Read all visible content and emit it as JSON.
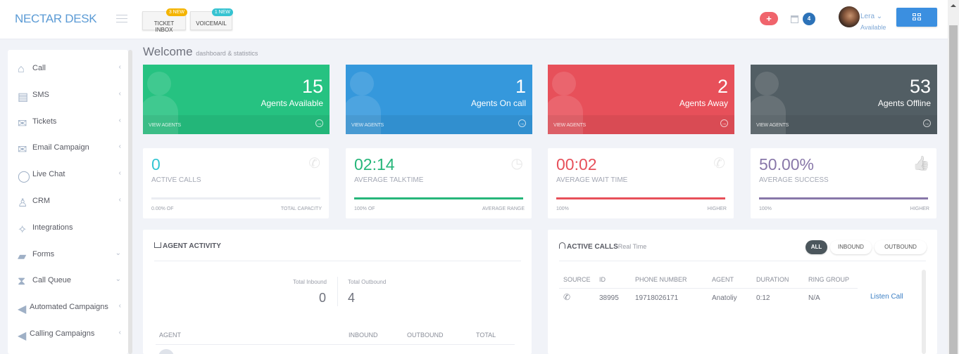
{
  "header": {
    "logo": "NECTAR DESK",
    "buttons": [
      {
        "label": "TICKET INBOX",
        "badge": "3 NEW",
        "badge_color": "#f4b400"
      },
      {
        "label": "VOICEMAIL",
        "badge": "1 NEW",
        "badge_color": "#36c3d1"
      }
    ],
    "plus_label": "+",
    "calendar_count": "4",
    "user": {
      "name": "Lera ⌄",
      "status": "Available"
    }
  },
  "sidebar": {
    "items": [
      {
        "label": "Call",
        "icon": "home-icon",
        "chevron": "‹"
      },
      {
        "label": "SMS",
        "icon": "message-icon",
        "chevron": "‹"
      },
      {
        "label": "Tickets",
        "icon": "envelope-icon",
        "chevron": "‹"
      },
      {
        "label": "Email Campaign",
        "icon": "envelope-icon",
        "chevron": "‹"
      },
      {
        "label": "Live Chat",
        "icon": "chat-bubble-icon",
        "chevron": "‹"
      },
      {
        "label": "CRM",
        "icon": "user-icon",
        "chevron": "‹"
      },
      {
        "label": "Integrations",
        "icon": "puzzle-icon",
        "chevron": ""
      },
      {
        "label": "Forms",
        "icon": "folder-icon",
        "chevron": "⌄"
      },
      {
        "label": "Call Queue",
        "icon": "hourglass-icon",
        "chevron": "⌄"
      },
      {
        "label": "Automated Campaigns",
        "icon": "megaphone-icon",
        "chevron": "‹"
      },
      {
        "label": "Calling Campaigns",
        "icon": "megaphone-icon",
        "chevron": "‹"
      }
    ]
  },
  "page": {
    "title": "Welcome",
    "subtitle": "dashboard & statistics"
  },
  "stat_cards": [
    {
      "value": "15",
      "label": "Agents Available",
      "link": "VIEW AGENTS",
      "color": "#26c281"
    },
    {
      "value": "1",
      "label": "Agents On call",
      "link": "VIEW AGENTS",
      "color": "#3598dc"
    },
    {
      "value": "2",
      "label": "Agents Away",
      "link": "VIEW AGENTS",
      "color": "#e7505a"
    },
    {
      "value": "53",
      "label": "Agents Offline",
      "link": "VIEW AGENTS",
      "color": "#525e64"
    }
  ],
  "kpis": [
    {
      "value": "0",
      "label": "ACTIVE CALLS",
      "left": "0.00% OF",
      "right": "TOTAL CAPACITY",
      "color": "#32c5d2",
      "progress": 0,
      "icon": "incoming-call-icon"
    },
    {
      "value": "02:14",
      "label": "AVERAGE TALKTIME",
      "left": "100% OF",
      "right": "AVERAGE RANGE",
      "color": "#26b67a",
      "progress": 100,
      "icon": "clock-icon"
    },
    {
      "value": "00:02",
      "label": "AVERAGE WAIT TIME",
      "left": "100%",
      "right": "HIGHER",
      "color": "#e7505a",
      "progress": 100,
      "icon": "phone-icon"
    },
    {
      "value": "50.00%",
      "label": "AVERAGE SUCCESS",
      "left": "100%",
      "right": "HIGHER",
      "color": "#8877a9",
      "progress": 100,
      "icon": "thumbs-up-icon"
    }
  ],
  "agent_activity": {
    "title": "AGENT ACTIVITY",
    "total_inbound_label": "Total Inbound",
    "total_inbound": "0",
    "total_outbound_label": "Total Outbound",
    "total_outbound": "4",
    "columns": [
      "AGENT",
      "INBOUND",
      "OUTBOUND",
      "TOTAL"
    ]
  },
  "active_calls": {
    "title": "ACTIVE CALLS",
    "subtitle": "Real Time",
    "filters": [
      "ALL",
      "INBOUND",
      "OUTBOUND"
    ],
    "active_filter": "ALL",
    "columns": [
      "SOURCE",
      "ID",
      "PHONE NUMBER",
      "AGENT",
      "DURATION",
      "RING GROUP"
    ],
    "rows": [
      {
        "source": "outgoing-call-icon",
        "id": "38995",
        "phone": "19718026171",
        "agent": "Anatoliy",
        "duration": "0:12",
        "ring_group": "N/A",
        "action": "Listen Call"
      }
    ]
  }
}
